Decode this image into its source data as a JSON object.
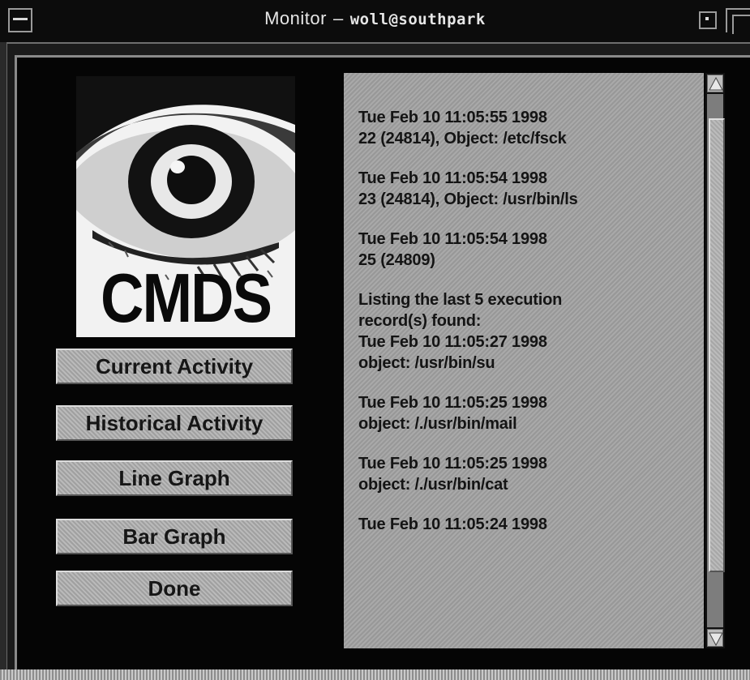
{
  "window": {
    "app_name": "Monitor",
    "separator": "–",
    "user_host": "woll@southpark"
  },
  "logo": {
    "text": "CMDS",
    "icon": "eye-icon"
  },
  "buttons": [
    {
      "id": "current",
      "label": "Current Activity"
    },
    {
      "id": "historical",
      "label": "Historical Activity"
    },
    {
      "id": "line",
      "label": "Line Graph"
    },
    {
      "id": "bar",
      "label": "Bar Graph"
    },
    {
      "id": "done",
      "label": "Done"
    }
  ],
  "log": {
    "entries": [
      {
        "lines": [
          "Tue Feb 10 11:05:55 1998",
          "22 (24814), Object: /etc/fsck"
        ]
      },
      {
        "lines": [
          "Tue Feb 10 11:05:54 1998",
          "23 (24814), Object: /usr/bin/ls"
        ]
      },
      {
        "lines": [
          "Tue Feb 10 11:05:54 1998",
          "25 (24809)"
        ]
      },
      {
        "lines": [
          "Listing the last 5 execution",
          "record(s) found:",
          "Tue Feb 10 11:05:27 1998",
          "object: /usr/bin/su"
        ]
      },
      {
        "lines": [
          "Tue Feb 10 11:05:25 1998",
          "object: /./usr/bin/mail"
        ]
      },
      {
        "lines": [
          "Tue Feb 10 11:05:25 1998",
          "object: /./usr/bin/cat"
        ]
      },
      {
        "lines": [
          "Tue Feb 10 11:05:24 1998"
        ]
      }
    ]
  },
  "scrollbar": {
    "up_icon": "triangle-up-icon",
    "down_icon": "triangle-down-icon"
  }
}
